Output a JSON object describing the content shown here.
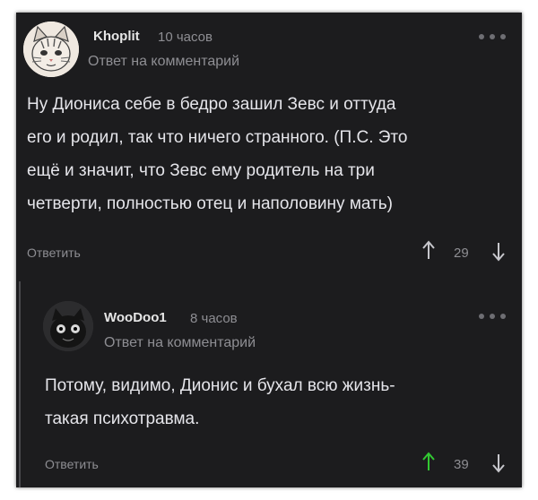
{
  "comments": [
    {
      "username": "Khoplit",
      "time": "10 часов",
      "reply_to": "Ответ на комментарий",
      "text": "Ну Диониса себе в бедро зашил Зевс и оттуда\nего и родил, так что ничего странного. (П.С. Это\nещё и значит, что Зевс ему родитель на три\nчетверти, полностью отец и наполовину мать)",
      "reply_label": "Ответить",
      "score": "29",
      "upvote_color": "#8e8e93",
      "avatar_icon": "cat-avatar-icon"
    },
    {
      "username": "WooDoo1",
      "time": "8 часов",
      "reply_to": "Ответ на комментарий",
      "text": "Потому, видимо, Дионис и бухал всю жизнь-\nтакая психотравма.",
      "reply_label": "Ответить",
      "score": "39",
      "upvote_color": "#32c832",
      "avatar_icon": "dark-creature-avatar-icon"
    }
  ]
}
